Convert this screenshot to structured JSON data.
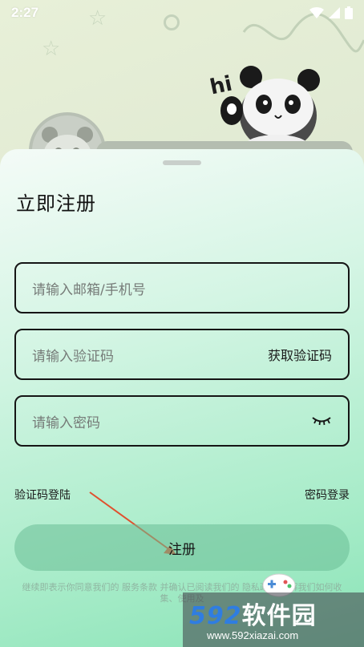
{
  "status_bar": {
    "time": "2:27"
  },
  "illustration": {
    "greeting": "hi"
  },
  "sheet": {
    "title": "立即注册",
    "email_field": {
      "placeholder": "请输入邮箱/手机号"
    },
    "code_field": {
      "placeholder": "请输入验证码",
      "action": "获取验证码"
    },
    "password_field": {
      "placeholder": "请输入密码"
    },
    "links": {
      "code_login": "验证码登陆",
      "password_login": "密码登录"
    },
    "register_button": "注册",
    "terms": "继续即表示你同意我们的 服务条款 并确认已阅读我们的 隐私政策 了解我们如何收集、使用及"
  },
  "watermark": {
    "brand_num": "592",
    "brand_text": "软件园",
    "url": "www.592xiazai.com"
  },
  "colors": {
    "accent": "#8ae3b7",
    "border": "#151515",
    "arrow": "#e0502e"
  }
}
